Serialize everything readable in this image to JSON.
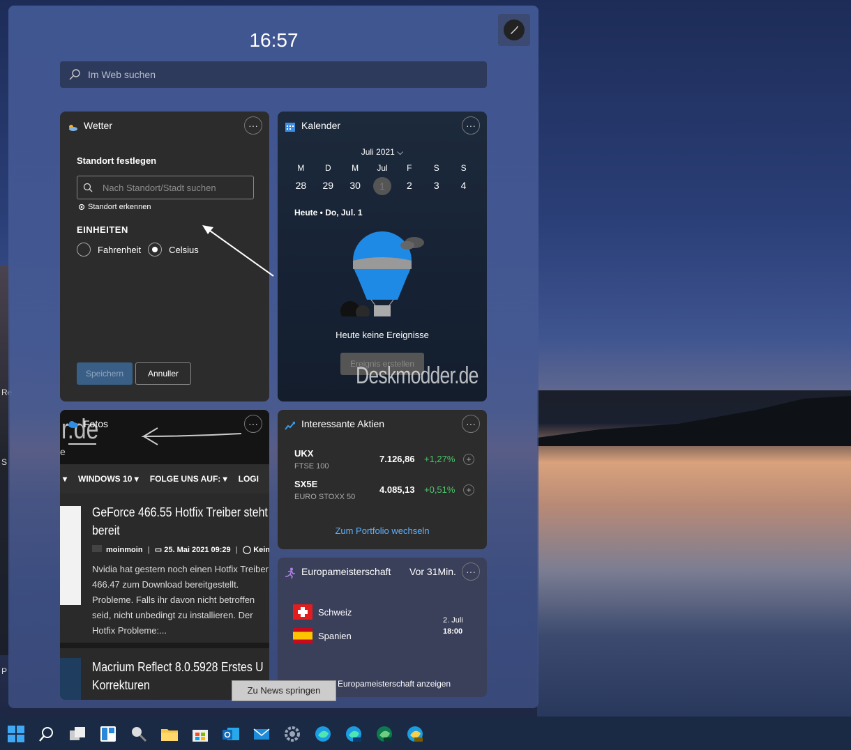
{
  "clock": "16:57",
  "search": {
    "placeholder": "Im Web suchen"
  },
  "desktop_edge_labels": [
    "Re",
    "S",
    "P"
  ],
  "weather": {
    "title": "Wetter",
    "set_location": "Standort festlegen",
    "location_placeholder": "Nach Standort/Stadt suchen",
    "detect_location": "Standort erkennen",
    "units_label": "EINHEITEN",
    "unit_fahrenheit": "Fahrenheit",
    "unit_celsius": "Celsius",
    "selected_unit": "Celsius",
    "save": "Speichern",
    "cancel": "Annuller",
    "more": "···"
  },
  "calendar": {
    "title": "Kalender",
    "month": "Juli 2021",
    "weekdays": [
      "M",
      "D",
      "M",
      "Jul",
      "F",
      "S",
      "S"
    ],
    "days": [
      "28",
      "29",
      "30",
      "1",
      "2",
      "3",
      "4"
    ],
    "today_index": 3,
    "today_label": "Heute • Do, Jul. 1",
    "no_events": "Heute keine Ereignisse",
    "create_event": "Ereignis erstellen",
    "more": "···"
  },
  "watermark": "Deskmodder.de",
  "photos": {
    "title": "Fotos",
    "site_logo_text": "r.de",
    "site_logo_sub": "e",
    "nav": [
      "▾",
      "WINDOWS 10 ▾",
      "FOLGE UNS AUF: ▾",
      "LOGI"
    ],
    "article1_title_line1": "GeForce 466.55 Hotfix Treiber steht",
    "article1_title_line2": "bereit",
    "article1_author": "moinmoin",
    "article1_date": "25. Mai 2021 09:29",
    "article1_comments": "Kein",
    "article1_body": "Nvidia hat gestern noch einen Hotfix Treiber 466.47 zum Download bereitgestellt. Probleme. Falls ihr davon nicht betroffen seid, nicht unbedingt zu installieren. Der Hotfix Probleme:...",
    "article2_title_line1": "Macrium Reflect 8.0.5928 Erstes U",
    "article2_title_line2": "Korrekturen",
    "more": "···"
  },
  "stocks": {
    "title": "Interessante Aktien",
    "items": [
      {
        "symbol": "UKX",
        "name": "FTSE 100",
        "value": "7.126,86",
        "change": "+1,27%"
      },
      {
        "symbol": "SX5E",
        "name": "EURO STOXX 50",
        "value": "4.085,13",
        "change": "+0,51%"
      }
    ],
    "add": "+",
    "portfolio_link": "Zum Portfolio wechseln",
    "more": "···"
  },
  "sports": {
    "title": "Europameisterschaft",
    "time_ago": "Vor 31Min.",
    "team1": "Schweiz",
    "team2": "Spanien",
    "match_date": "2. Juli",
    "match_time": "18:00",
    "link": "Europameisterschaft anzeigen",
    "more": "···"
  },
  "jump_button": "Zu News springen",
  "taskbar_icons": [
    "windows-start-icon",
    "search-icon",
    "task-view-icon",
    "widgets-icon",
    "magnifier-icon",
    "file-explorer-icon",
    "store-icon",
    "outlook-icon",
    "mail-icon",
    "settings-icon",
    "edge-icon",
    "edge-beta-icon",
    "edge-dev-icon",
    "edge-canary-icon"
  ],
  "colors": {
    "accent_link": "#5fb2ff",
    "positive_change": "#4cc96a",
    "taskbar": "#1a2a44"
  }
}
